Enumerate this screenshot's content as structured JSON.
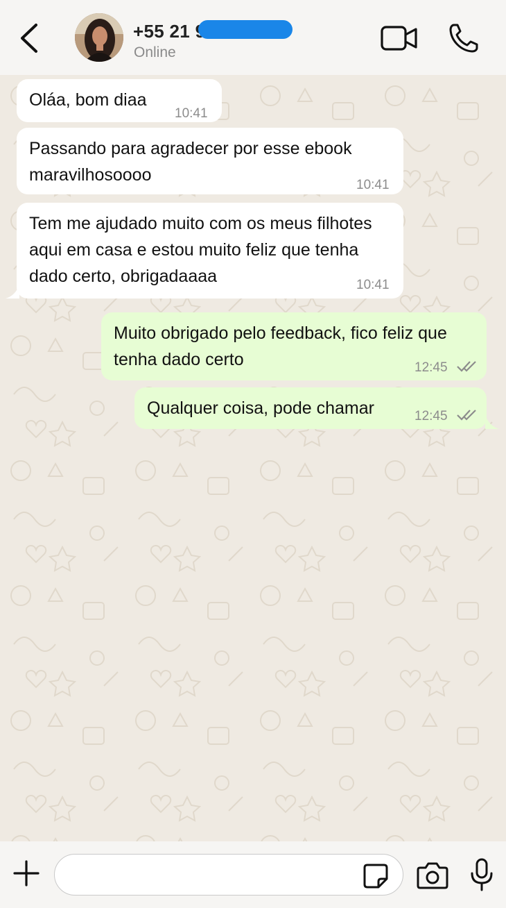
{
  "header": {
    "contact_name": "+55 21 9     4082",
    "status": "Online",
    "icons": {
      "back": "chevron-left-icon",
      "video": "video-camera-icon",
      "call": "phone-icon"
    }
  },
  "messages": [
    {
      "direction": "incoming",
      "text": "Oláa, bom diaa",
      "time": "10:41"
    },
    {
      "direction": "incoming",
      "text": "Passando para agradecer por esse ebook maravilhosoooo",
      "time": "10:41"
    },
    {
      "direction": "incoming",
      "text": "Tem me ajudado muito com os meus filhotes aqui em casa e estou muito feliz que tenha dado certo, obrigadaaaa",
      "time": "10:41"
    },
    {
      "direction": "outgoing",
      "text": "Muito obrigado pelo feedback, fico feliz que tenha dado certo",
      "time": "12:45",
      "status": "read"
    },
    {
      "direction": "outgoing",
      "text": "Qualquer coisa, pode chamar",
      "time": "12:45",
      "status": "read"
    }
  ],
  "composer": {
    "placeholder": "",
    "icons": {
      "attach": "plus-icon",
      "sticker": "sticker-icon",
      "camera": "camera-icon",
      "mic": "microphone-icon"
    }
  },
  "colors": {
    "incoming_bubble": "#ffffff",
    "outgoing_bubble": "#e7fdd4",
    "chat_background": "#efeae2",
    "header_background": "#f6f5f3",
    "read_ticks": "#8c8c8c"
  }
}
